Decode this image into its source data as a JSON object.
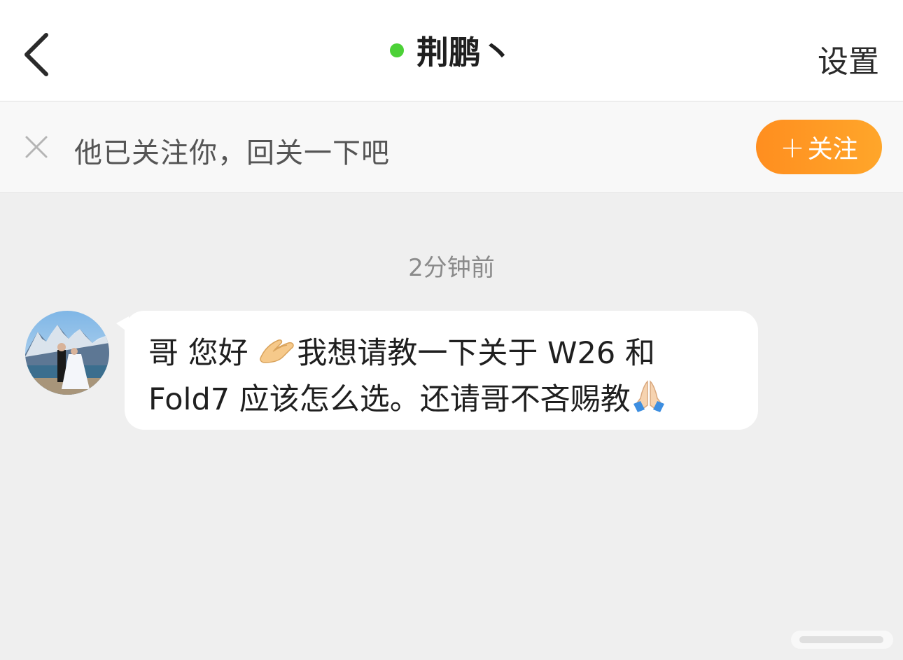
{
  "header": {
    "title": "荆鹏丶",
    "settings_label": "设置",
    "back_icon": "chevron-left-icon",
    "online_status_color": "#4cd137"
  },
  "follow_bar": {
    "message": "他已关注你，回关一下吧",
    "button_plus": "+",
    "button_label": "关注",
    "close_icon": "close-icon",
    "accent_color": "#ff9522"
  },
  "chat": {
    "timestamp": "2分钟前",
    "messages": [
      {
        "sender": "other",
        "line1_a": "哥 您好 ",
        "emoji1": "pinched-hands-emoji",
        "line1_b": "我想请教一下关于 W26 和",
        "line2": "Fold7 应该怎么选。还请哥不吝赐教",
        "emoji2": "folded-hands-emoji"
      }
    ]
  }
}
